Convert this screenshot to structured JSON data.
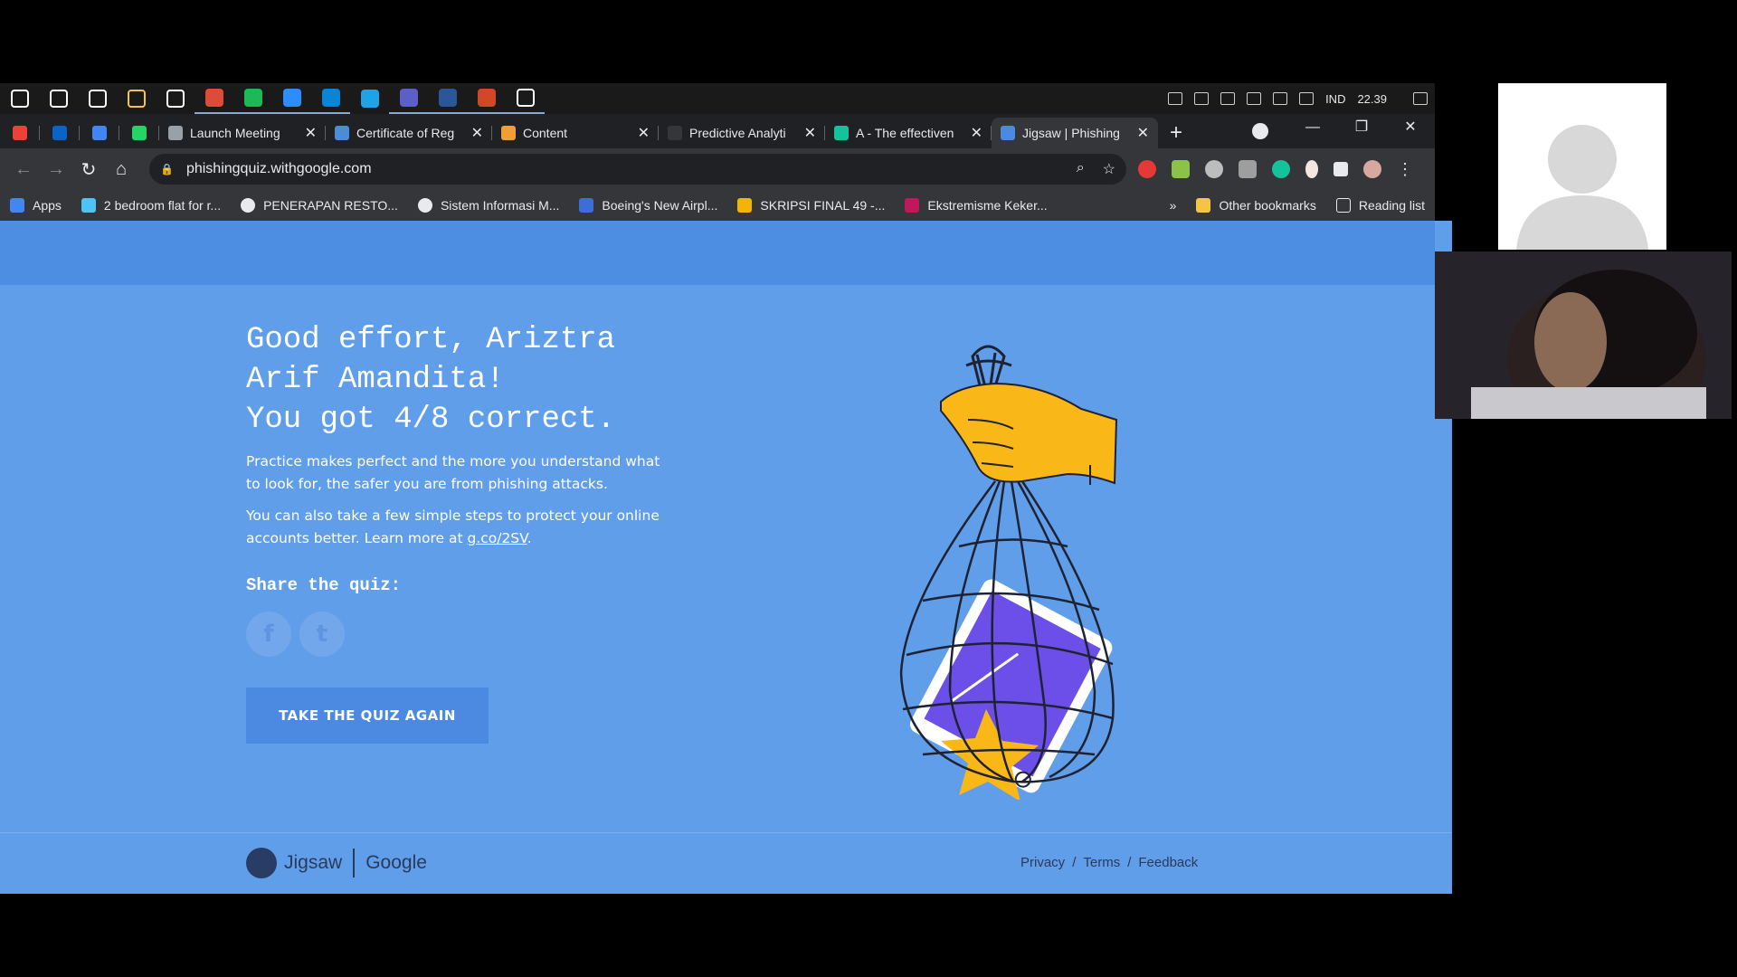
{
  "taskbar": {
    "icons": [
      {
        "name": "windows-start-icon",
        "color": "#ffffff"
      },
      {
        "name": "search-icon",
        "color": "#ffffff"
      },
      {
        "name": "cortana-icon",
        "color": "#ffffff"
      },
      {
        "name": "file-explorer-icon",
        "color": "#f4c542"
      },
      {
        "name": "store-icon",
        "color": "#ffffff"
      },
      {
        "name": "chrome-icon",
        "color": "#de4b39"
      },
      {
        "name": "spotify-icon",
        "color": "#1db954"
      },
      {
        "name": "zoom-icon",
        "color": "#2d8cff"
      },
      {
        "name": "mail-icon",
        "color": "#0a84d6"
      },
      {
        "name": "edge-icon",
        "color": "#1fa3e8"
      },
      {
        "name": "teams-icon",
        "color": "#5b5fc7"
      },
      {
        "name": "word-icon",
        "color": "#2b579a"
      },
      {
        "name": "powerpoint-icon",
        "color": "#d24726"
      },
      {
        "name": "settings-icon",
        "color": "#ffffff"
      }
    ],
    "tray": {
      "language": "IND",
      "time": "22.39"
    }
  },
  "tabs": [
    {
      "title": "",
      "pinned": true,
      "icon": "gmail-icon",
      "color": "#ea4335"
    },
    {
      "title": "",
      "pinned": true,
      "icon": "outlook-icon",
      "color": "#0a64c8"
    },
    {
      "title": "",
      "pinned": true,
      "icon": "calendar-icon",
      "color": "#4285f4"
    },
    {
      "title": "",
      "pinned": true,
      "icon": "whatsapp-icon",
      "color": "#25d366"
    },
    {
      "title": "Launch Meeting",
      "icon": "globe-icon",
      "color": "#9aa0a6"
    },
    {
      "title": "Certificate of Reg",
      "icon": "document-icon",
      "color": "#4a8cd8"
    },
    {
      "title": "Content",
      "icon": "content-icon",
      "color": "#f0a030"
    },
    {
      "title": "Predictive Analyti",
      "icon": "blackboard-icon",
      "color": "#35363a"
    },
    {
      "title": "A - The effectiven",
      "icon": "grammarly-icon",
      "color": "#15c39a"
    },
    {
      "title": "Jigsaw | Phishing",
      "icon": "jigsaw-icon",
      "color": "#4a8ae0",
      "active": true
    }
  ],
  "address_bar": {
    "url": "phishingquiz.withgoogle.com"
  },
  "bookmarks": {
    "items": [
      {
        "label": "Apps",
        "color": "#4285f4"
      },
      {
        "label": "2 bedroom flat for r...",
        "color": "#4fc3f7"
      },
      {
        "label": "PENERAPAN RESTO...",
        "color": "#e8eaed"
      },
      {
        "label": "Sistem Informasi M...",
        "color": "#e8eaed"
      },
      {
        "label": "Boeing's New Airpl...",
        "color": "#3a6fd8"
      },
      {
        "label": "SKRIPSI FINAL 49 -...",
        "color": "#f4b400"
      },
      {
        "label": "Ekstremisme Keker...",
        "color": "#c2185b"
      }
    ],
    "more": "»",
    "other": "Other bookmarks",
    "reading_list": "Reading list"
  },
  "result": {
    "line1": "Good effort, Ariztra",
    "line2": "Arif Amandita!",
    "line3": "You got 4/8 correct.",
    "para1": "Practice makes perfect and the more you understand what to look for, the safer you are from phishing attacks.",
    "para2_prefix": "You can also take a few simple steps to protect your online accounts better. Learn more at ",
    "para2_link": "g.co/2SV",
    "para2_suffix": ".",
    "share_label": "Share the quiz:",
    "facebook_glyph": "f",
    "twitter_glyph": "t",
    "retake_label": "TAKE THE QUIZ AGAIN"
  },
  "footer": {
    "brand_jigsaw": "Jigsaw",
    "brand_google": "Google",
    "links": [
      "Privacy",
      "Terms",
      "Feedback"
    ],
    "separator": "/"
  },
  "colors": {
    "page_bg": "#619ee9",
    "header_bg": "#4e8ee2",
    "button_bg": "#4b8ae0",
    "hand": "#f9b817",
    "phone": "#6c4ee8"
  }
}
